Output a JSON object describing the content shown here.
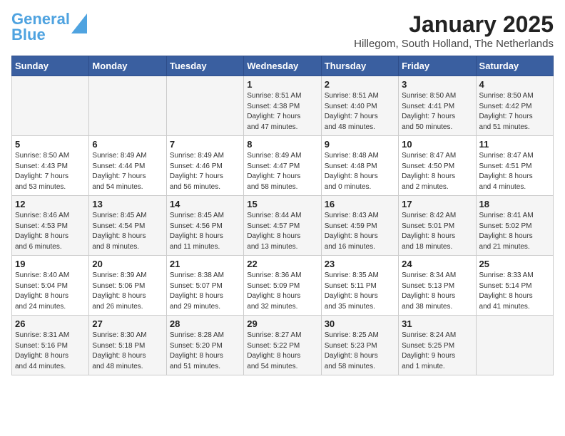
{
  "logo": {
    "text1": "General",
    "text2": "Blue"
  },
  "title": "January 2025",
  "location": "Hillegom, South Holland, The Netherlands",
  "headers": [
    "Sunday",
    "Monday",
    "Tuesday",
    "Wednesday",
    "Thursday",
    "Friday",
    "Saturday"
  ],
  "weeks": [
    [
      {
        "day": "",
        "info": ""
      },
      {
        "day": "",
        "info": ""
      },
      {
        "day": "",
        "info": ""
      },
      {
        "day": "1",
        "info": "Sunrise: 8:51 AM\nSunset: 4:38 PM\nDaylight: 7 hours\nand 47 minutes."
      },
      {
        "day": "2",
        "info": "Sunrise: 8:51 AM\nSunset: 4:40 PM\nDaylight: 7 hours\nand 48 minutes."
      },
      {
        "day": "3",
        "info": "Sunrise: 8:50 AM\nSunset: 4:41 PM\nDaylight: 7 hours\nand 50 minutes."
      },
      {
        "day": "4",
        "info": "Sunrise: 8:50 AM\nSunset: 4:42 PM\nDaylight: 7 hours\nand 51 minutes."
      }
    ],
    [
      {
        "day": "5",
        "info": "Sunrise: 8:50 AM\nSunset: 4:43 PM\nDaylight: 7 hours\nand 53 minutes."
      },
      {
        "day": "6",
        "info": "Sunrise: 8:49 AM\nSunset: 4:44 PM\nDaylight: 7 hours\nand 54 minutes."
      },
      {
        "day": "7",
        "info": "Sunrise: 8:49 AM\nSunset: 4:46 PM\nDaylight: 7 hours\nand 56 minutes."
      },
      {
        "day": "8",
        "info": "Sunrise: 8:49 AM\nSunset: 4:47 PM\nDaylight: 7 hours\nand 58 minutes."
      },
      {
        "day": "9",
        "info": "Sunrise: 8:48 AM\nSunset: 4:48 PM\nDaylight: 8 hours\nand 0 minutes."
      },
      {
        "day": "10",
        "info": "Sunrise: 8:47 AM\nSunset: 4:50 PM\nDaylight: 8 hours\nand 2 minutes."
      },
      {
        "day": "11",
        "info": "Sunrise: 8:47 AM\nSunset: 4:51 PM\nDaylight: 8 hours\nand 4 minutes."
      }
    ],
    [
      {
        "day": "12",
        "info": "Sunrise: 8:46 AM\nSunset: 4:53 PM\nDaylight: 8 hours\nand 6 minutes."
      },
      {
        "day": "13",
        "info": "Sunrise: 8:45 AM\nSunset: 4:54 PM\nDaylight: 8 hours\nand 8 minutes."
      },
      {
        "day": "14",
        "info": "Sunrise: 8:45 AM\nSunset: 4:56 PM\nDaylight: 8 hours\nand 11 minutes."
      },
      {
        "day": "15",
        "info": "Sunrise: 8:44 AM\nSunset: 4:57 PM\nDaylight: 8 hours\nand 13 minutes."
      },
      {
        "day": "16",
        "info": "Sunrise: 8:43 AM\nSunset: 4:59 PM\nDaylight: 8 hours\nand 16 minutes."
      },
      {
        "day": "17",
        "info": "Sunrise: 8:42 AM\nSunset: 5:01 PM\nDaylight: 8 hours\nand 18 minutes."
      },
      {
        "day": "18",
        "info": "Sunrise: 8:41 AM\nSunset: 5:02 PM\nDaylight: 8 hours\nand 21 minutes."
      }
    ],
    [
      {
        "day": "19",
        "info": "Sunrise: 8:40 AM\nSunset: 5:04 PM\nDaylight: 8 hours\nand 24 minutes."
      },
      {
        "day": "20",
        "info": "Sunrise: 8:39 AM\nSunset: 5:06 PM\nDaylight: 8 hours\nand 26 minutes."
      },
      {
        "day": "21",
        "info": "Sunrise: 8:38 AM\nSunset: 5:07 PM\nDaylight: 8 hours\nand 29 minutes."
      },
      {
        "day": "22",
        "info": "Sunrise: 8:36 AM\nSunset: 5:09 PM\nDaylight: 8 hours\nand 32 minutes."
      },
      {
        "day": "23",
        "info": "Sunrise: 8:35 AM\nSunset: 5:11 PM\nDaylight: 8 hours\nand 35 minutes."
      },
      {
        "day": "24",
        "info": "Sunrise: 8:34 AM\nSunset: 5:13 PM\nDaylight: 8 hours\nand 38 minutes."
      },
      {
        "day": "25",
        "info": "Sunrise: 8:33 AM\nSunset: 5:14 PM\nDaylight: 8 hours\nand 41 minutes."
      }
    ],
    [
      {
        "day": "26",
        "info": "Sunrise: 8:31 AM\nSunset: 5:16 PM\nDaylight: 8 hours\nand 44 minutes."
      },
      {
        "day": "27",
        "info": "Sunrise: 8:30 AM\nSunset: 5:18 PM\nDaylight: 8 hours\nand 48 minutes."
      },
      {
        "day": "28",
        "info": "Sunrise: 8:28 AM\nSunset: 5:20 PM\nDaylight: 8 hours\nand 51 minutes."
      },
      {
        "day": "29",
        "info": "Sunrise: 8:27 AM\nSunset: 5:22 PM\nDaylight: 8 hours\nand 54 minutes."
      },
      {
        "day": "30",
        "info": "Sunrise: 8:25 AM\nSunset: 5:23 PM\nDaylight: 8 hours\nand 58 minutes."
      },
      {
        "day": "31",
        "info": "Sunrise: 8:24 AM\nSunset: 5:25 PM\nDaylight: 9 hours\nand 1 minute."
      },
      {
        "day": "",
        "info": ""
      }
    ]
  ]
}
